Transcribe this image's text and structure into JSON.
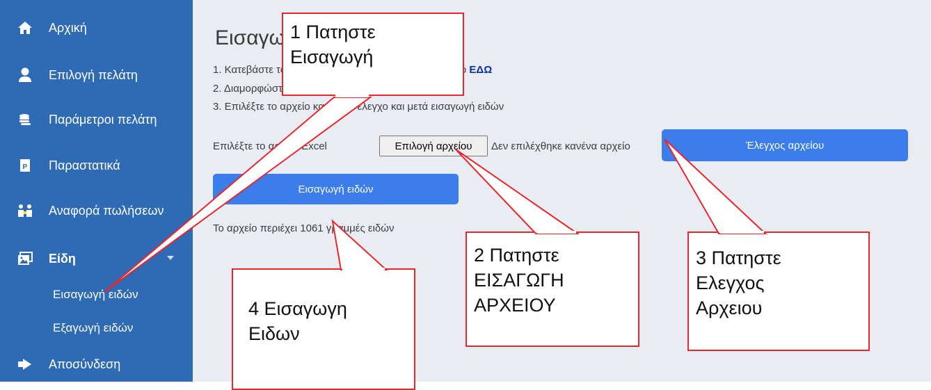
{
  "sidebar": {
    "items": [
      {
        "label": "Αρχική",
        "icon": "home-icon"
      },
      {
        "label": "Επιλογή πελάτη",
        "icon": "user-icon"
      },
      {
        "label": "Παράμετροι πελάτη",
        "icon": "coins-icon"
      },
      {
        "label": "Παραστατικά",
        "icon": "document-p-icon"
      },
      {
        "label": "Αναφορά πωλήσεων",
        "icon": "people-report-icon"
      },
      {
        "label": "Είδη",
        "icon": "images-icon"
      },
      {
        "label": "Αποσύνδεση",
        "icon": "logout-icon"
      }
    ],
    "submenu": [
      {
        "label": "Εισαγωγή ειδών"
      },
      {
        "label": "Εξαγωγή ειδών"
      }
    ]
  },
  "main": {
    "title": "Εισαγωγή ειδών από excel",
    "steps": [
      {
        "text": "1. Κατεβάστε το πρότυπο αρχείο εισαγωγής ειδών από ",
        "link": "ΕΔΩ"
      },
      {
        "text": "2. Διαμορφώστε το αρχείο με τα είδη"
      },
      {
        "text": "3. Επιλέξτε το αρχείο και κάντε έλεγχο και μετά εισαγωγή ειδών"
      }
    ],
    "file_label": "Επιλέξτε το αρχείο Excel",
    "file_button": "Επιλογή αρχείου",
    "file_status": "Δεν επιλέχθηκε κανένα αρχείο",
    "check_button": "Έλεγχος αρχείου",
    "import_button": "Εισαγωγή ειδών",
    "count_text": "Το αρχείο περιέχει 1061 γραμμές ειδών"
  },
  "callouts": [
    {
      "text": "1 Πατηστε\nΕισαγωγή"
    },
    {
      "text": "2 Πατηστε\nΕΙΣΑΓΩΓΗ\nΑΡΧΕΙΟΥ"
    },
    {
      "text": "3 Πατηστε\nΕλεγχος\nΑρχειου"
    },
    {
      "text": "4 Εισαγωγη\nΕιδων"
    }
  ],
  "colors": {
    "sidebar": "#2f6bb4",
    "main_bg": "#e9ecf3",
    "button": "#3b7dea",
    "callout_border": "#e8262c",
    "link": "#0b2fa8"
  }
}
